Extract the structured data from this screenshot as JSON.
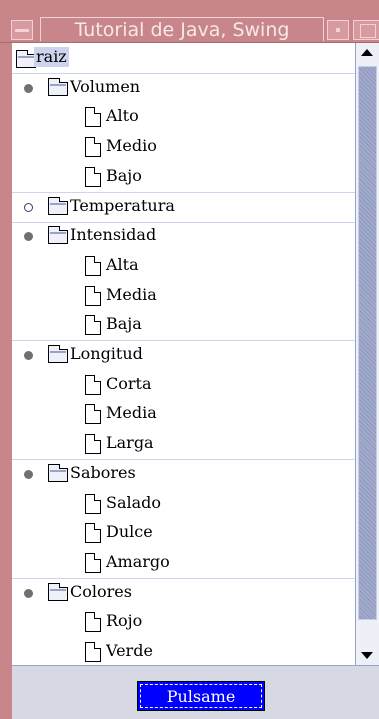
{
  "window": {
    "title": "Tutorial de Java, Swing"
  },
  "tree": {
    "root": "raiz",
    "groups": [
      {
        "label": "Volumen",
        "expanded": true,
        "children": [
          "Alto",
          "Medio",
          "Bajo"
        ]
      },
      {
        "label": "Temperatura",
        "expanded": false,
        "children": []
      },
      {
        "label": "Intensidad",
        "expanded": true,
        "children": [
          "Alta",
          "Media",
          "Baja"
        ]
      },
      {
        "label": "Longitud",
        "expanded": true,
        "children": [
          "Corta",
          "Media",
          "Larga"
        ]
      },
      {
        "label": "Sabores",
        "expanded": true,
        "children": [
          "Salado",
          "Dulce",
          "Amargo"
        ]
      },
      {
        "label": "Colores",
        "expanded": true,
        "children": [
          "Rojo",
          "Verde"
        ]
      }
    ]
  },
  "button": {
    "label": "Pulsame"
  },
  "colors": {
    "titlebar": "#c8868b",
    "button_bg": "#0000ff",
    "selection": "#ccd4ee"
  }
}
